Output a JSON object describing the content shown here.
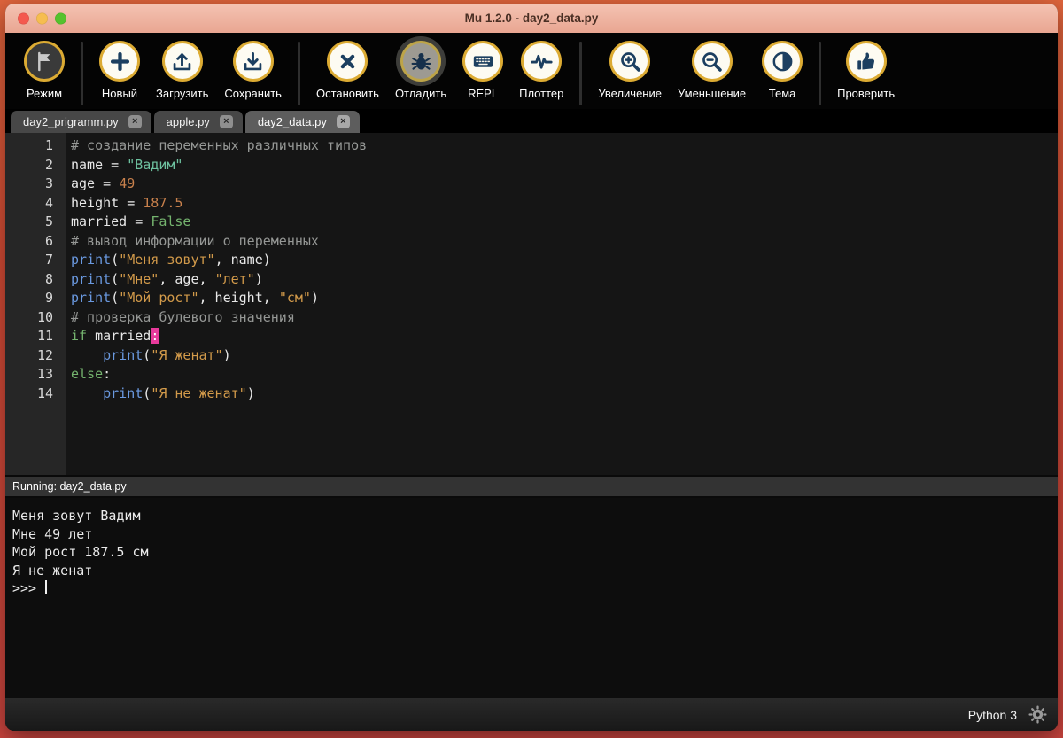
{
  "window": {
    "title": "Mu 1.2.0 - day2_data.py"
  },
  "toolbar": {
    "groups": [
      [
        {
          "name": "mode",
          "label": "Режим",
          "icon": "mode-flag-icon",
          "glyph": "flag",
          "style": "dark"
        }
      ],
      [
        {
          "name": "new",
          "label": "Новый",
          "icon": "new-plus-icon",
          "glyph": "plus"
        },
        {
          "name": "load",
          "label": "Загрузить",
          "icon": "load-upload-icon",
          "glyph": "upload"
        },
        {
          "name": "save",
          "label": "Сохранить",
          "icon": "save-download-icon",
          "glyph": "download"
        }
      ],
      [
        {
          "name": "stop",
          "label": "Остановить",
          "icon": "stop-x-icon",
          "glyph": "stop"
        },
        {
          "name": "debug",
          "label": "Отладить",
          "icon": "debug-bug-icon",
          "glyph": "bug",
          "active": true
        },
        {
          "name": "repl",
          "label": "REPL",
          "icon": "repl-keyboard-icon",
          "glyph": "keyboard"
        },
        {
          "name": "plotter",
          "label": "Плоттер",
          "icon": "plotter-wave-icon",
          "glyph": "wave"
        }
      ],
      [
        {
          "name": "zoom-in",
          "label": "Увеличение",
          "icon": "zoom-in-icon",
          "glyph": "zoomin"
        },
        {
          "name": "zoom-out",
          "label": "Уменьшение",
          "icon": "zoom-out-icon",
          "glyph": "zoomout"
        },
        {
          "name": "theme",
          "label": "Тема",
          "icon": "theme-half-circle-icon",
          "glyph": "theme"
        }
      ],
      [
        {
          "name": "check",
          "label": "Проверить",
          "icon": "check-thumbsup-icon",
          "glyph": "thumbsup"
        }
      ]
    ]
  },
  "tabs": [
    {
      "label": "day2_prigramm.py",
      "active": false
    },
    {
      "label": "apple.py",
      "active": false
    },
    {
      "label": "day2_data.py",
      "active": true
    }
  ],
  "editor": {
    "lines": [
      {
        "n": "1",
        "t": [
          [
            "comment",
            "# создание переменных различных типов"
          ]
        ]
      },
      {
        "n": "2",
        "t": [
          [
            "plain",
            "name = "
          ],
          [
            "strg",
            "\"Вадим\""
          ]
        ]
      },
      {
        "n": "3",
        "t": [
          [
            "plain",
            "age = "
          ],
          [
            "num",
            "49"
          ]
        ]
      },
      {
        "n": "4",
        "t": [
          [
            "plain",
            "height = "
          ],
          [
            "num",
            "187.5"
          ]
        ]
      },
      {
        "n": "5",
        "t": [
          [
            "plain",
            "married = "
          ],
          [
            "kw",
            "False"
          ]
        ]
      },
      {
        "n": "6",
        "t": [
          [
            "comment",
            "# вывод информации о переменных"
          ]
        ]
      },
      {
        "n": "7",
        "t": [
          [
            "fn",
            "print"
          ],
          [
            "plain",
            "("
          ],
          [
            "str",
            "\"Меня зовут\""
          ],
          [
            "plain",
            ", name)"
          ]
        ]
      },
      {
        "n": "8",
        "t": [
          [
            "fn",
            "print"
          ],
          [
            "plain",
            "("
          ],
          [
            "str",
            "\"Мне\""
          ],
          [
            "plain",
            ", age, "
          ],
          [
            "str",
            "\"лет\""
          ],
          [
            "plain",
            ")"
          ]
        ]
      },
      {
        "n": "9",
        "t": [
          [
            "fn",
            "print"
          ],
          [
            "plain",
            "("
          ],
          [
            "str",
            "\"Мой рост\""
          ],
          [
            "plain",
            ", height, "
          ],
          [
            "str",
            "\"см\""
          ],
          [
            "plain",
            ")"
          ]
        ]
      },
      {
        "n": "10",
        "t": [
          [
            "comment",
            "# проверка булевого значения"
          ]
        ]
      },
      {
        "n": "11",
        "t": [
          [
            "kw",
            "if"
          ],
          [
            "plain",
            " married"
          ],
          [
            "cursor",
            ":"
          ]
        ]
      },
      {
        "n": "12",
        "t": [
          [
            "plain",
            "    "
          ],
          [
            "fn",
            "print"
          ],
          [
            "plain",
            "("
          ],
          [
            "str",
            "\"Я женат\""
          ],
          [
            "plain",
            ")"
          ]
        ]
      },
      {
        "n": "13",
        "t": [
          [
            "kw",
            "else"
          ],
          [
            "plain",
            ":"
          ]
        ]
      },
      {
        "n": "14",
        "t": [
          [
            "plain",
            "    "
          ],
          [
            "fn",
            "print"
          ],
          [
            "plain",
            "("
          ],
          [
            "str",
            "\"Я не женат\""
          ],
          [
            "plain",
            ")"
          ]
        ]
      }
    ]
  },
  "runbar": {
    "text": "Running: day2_data.py"
  },
  "repl": {
    "output_lines": [
      "Меня зовут Вадим",
      "Мне 49 лет",
      "Мой рост 187.5 см",
      "Я не женат"
    ],
    "prompt": ">>> "
  },
  "statusbar": {
    "mode_label": "Python 3"
  },
  "palette": {
    "desktop_frame": "#d44b35",
    "titlebar": "#efb4a2",
    "traffic_red": "#f4594e",
    "traffic_yellow": "#f6bd4f",
    "traffic_green": "#55c22d",
    "toolbar_bg": "#040404",
    "icon_ring_yellow": "#dcab33",
    "icon_glyph_navy": "#1c3f60",
    "tab_bg": "#474747",
    "tab_active_bg": "#5d5d5d",
    "editor_bg": "#151515",
    "gutter_bg": "#262626",
    "comment": "#969896",
    "string_gold": "#d29a4a",
    "string_teal": "#6ec2a0",
    "number_orange": "#c9814c",
    "keyword_green": "#74b36e",
    "function_blue": "#6a99e0",
    "cursor_pink": "#e83a9c",
    "repl_bg": "#0d0d0d",
    "text": "#e8e8e8"
  }
}
